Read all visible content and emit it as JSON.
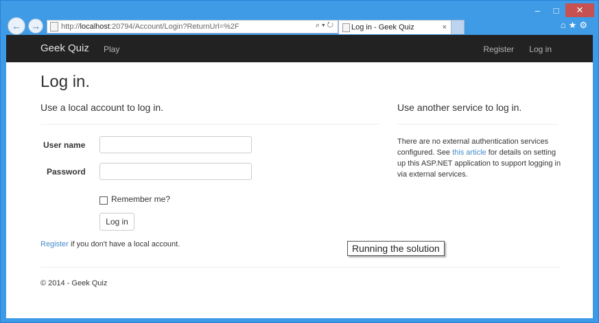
{
  "browser": {
    "url_prefix": "http://",
    "url_host": "localhost",
    "url_rest": ":20794/Account/Login?ReturnUrl=%2F",
    "address_tools": "⌕ ▾ ↻",
    "tab_title": "Log in - Geek Quiz",
    "tab_close": "×",
    "controls": {
      "minimize": "‒",
      "maximize": "□",
      "close": "✕"
    },
    "right_icons": "⌂★⚙"
  },
  "navbar": {
    "brand": "Geek Quiz",
    "play": "Play",
    "register": "Register",
    "login": "Log in"
  },
  "page": {
    "title": "Log in.",
    "local_heading": "Use a local account to log in.",
    "username_label": "User name",
    "username_value": "",
    "password_label": "Password",
    "password_value": "",
    "remember_label": "Remember me?",
    "login_button": "Log in",
    "register_link": "Register",
    "register_suffix": " if you don't have a local account.",
    "external_heading": "Use another service to log in.",
    "external_text_1": "There are no external authentication services configured. See ",
    "external_link": "this article",
    "external_text_2": " for details on setting up this ASP.NET application to support logging in via external services.",
    "footer": "© 2014 - Geek Quiz"
  },
  "overlay": {
    "caption": "Running the solution"
  }
}
